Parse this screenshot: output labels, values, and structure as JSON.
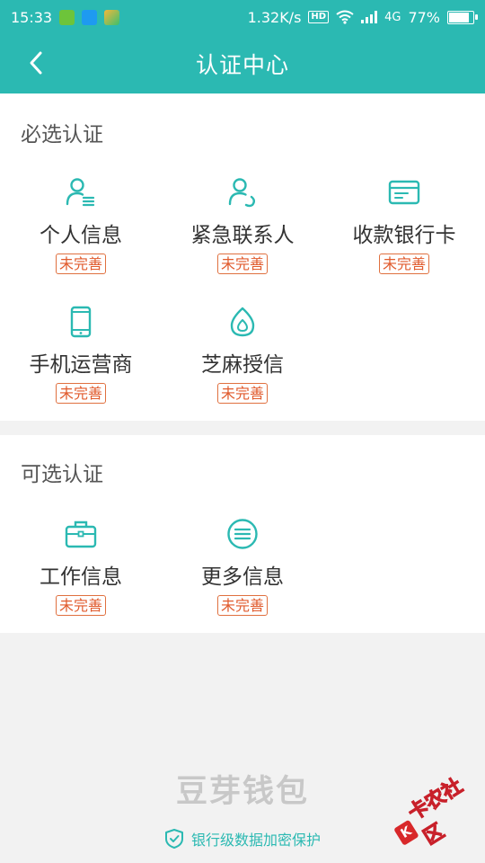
{
  "status_bar": {
    "time": "15:33",
    "net_speed": "1.32K/s",
    "hd_label": "HD",
    "network_type": "4G",
    "battery_percent": "77%",
    "battery_level": 0.77,
    "app_icons": [
      "wechat-icon",
      "scan-icon",
      "maps-icon"
    ]
  },
  "nav": {
    "title": "认证中心",
    "back_icon": "chevron-left-icon"
  },
  "required_section": {
    "title": "必选认证",
    "items": [
      {
        "label": "个人信息",
        "status": "未完善",
        "icon": "person-list-icon"
      },
      {
        "label": "紧急联系人",
        "status": "未完善",
        "icon": "person-phone-icon"
      },
      {
        "label": "收款银行卡",
        "status": "未完善",
        "icon": "bank-card-icon"
      },
      {
        "label": "手机运营商",
        "status": "未完善",
        "icon": "mobile-phone-icon"
      },
      {
        "label": "芝麻授信",
        "status": "未完善",
        "icon": "sesame-drop-icon"
      }
    ]
  },
  "optional_section": {
    "title": "可选认证",
    "items": [
      {
        "label": "工作信息",
        "status": "未完善",
        "icon": "briefcase-icon"
      },
      {
        "label": "更多信息",
        "status": "未完善",
        "icon": "more-lines-icon"
      }
    ]
  },
  "footer": {
    "brand": "豆芽钱包",
    "security_text": "银行级数据加密保护",
    "security_icon": "shield-check-icon"
  },
  "watermark": {
    "text": "卡农社区",
    "mark": "K"
  },
  "colors": {
    "primary": "#2bb9b2",
    "badge": "#e05a2c",
    "background": "#f2f2f2"
  }
}
